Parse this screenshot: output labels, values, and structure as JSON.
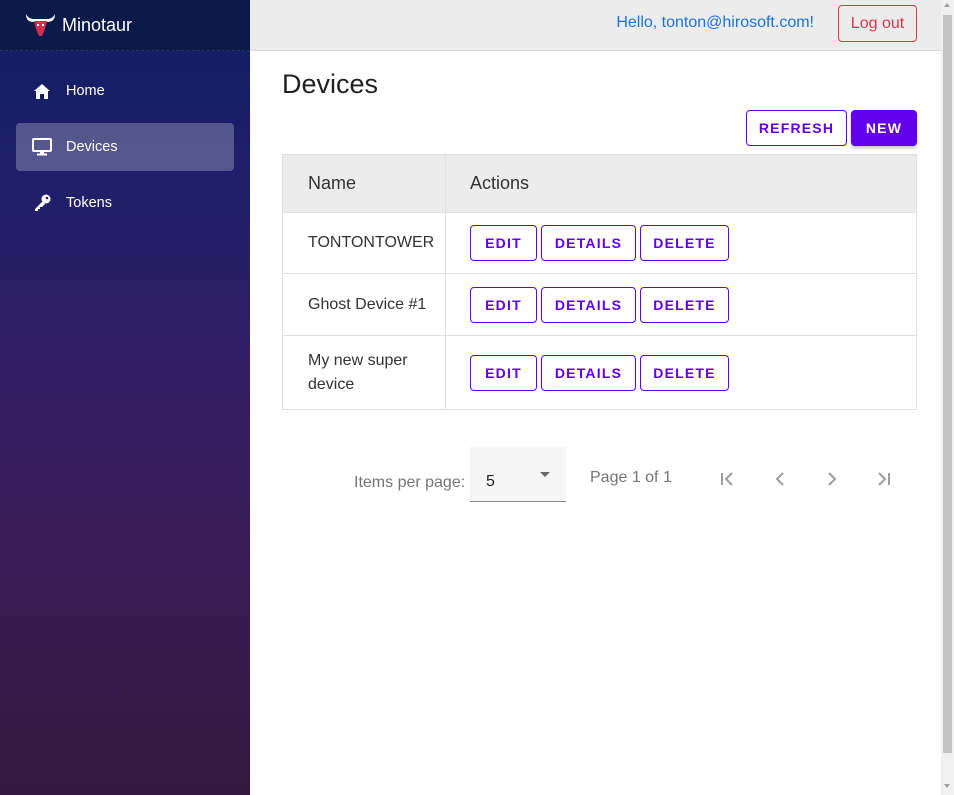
{
  "app": {
    "name": "Minotaur"
  },
  "sidebar": {
    "items": [
      {
        "label": "Home",
        "icon": "home-icon",
        "active": false
      },
      {
        "label": "Devices",
        "icon": "monitor-icon",
        "active": true
      },
      {
        "label": "Tokens",
        "icon": "key-icon",
        "active": false
      }
    ]
  },
  "header": {
    "greeting": "Hello, tonton@hirosoft.com!",
    "logout_label": "Log out"
  },
  "page": {
    "title": "Devices",
    "refresh_label": "Refresh",
    "new_label": "New"
  },
  "table": {
    "columns": [
      "Name",
      "Actions"
    ],
    "rows": [
      {
        "name": "TONTONTOWER",
        "edit": "Edit",
        "details": "Details",
        "delete": "Delete"
      },
      {
        "name": "Ghost Device #1",
        "edit": "Edit",
        "details": "Details",
        "delete": "Delete"
      },
      {
        "name": "My new super device",
        "edit": "Edit",
        "details": "Details",
        "delete": "Delete"
      }
    ]
  },
  "paginator": {
    "items_per_page_label": "Items per page:",
    "items_per_page_value": "5",
    "range_label": "Page 1 of 1"
  },
  "colors": {
    "primary": "#6200ee",
    "danger": "#dc3545",
    "link": "#1a73d9"
  }
}
